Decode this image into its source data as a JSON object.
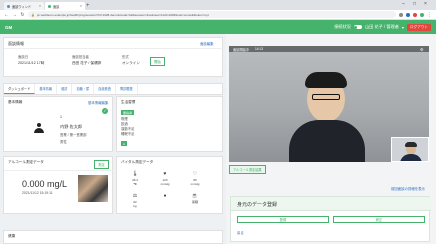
{
  "browser": {
    "tabs": [
      {
        "label": "面談ウィンド",
        "active": false
      },
      {
        "label": "面談",
        "active": true
      }
    ],
    "url": "pc.webdemo.example.jp/health/prog/session/?id=1028-demo&mode=full&session=live&view=1120-2048&role=consult&token=xyz",
    "new_tab": "+",
    "win_controls": [
      "–",
      "□",
      "×"
    ]
  },
  "app_header": {
    "logo": "GM",
    "status_label": "接続状況",
    "user_label": "山田 花子 / 管理者",
    "logout_label": "ログアウト"
  },
  "consult_info": {
    "title": "面談情報",
    "edit_link": "面談編集",
    "fields": [
      {
        "label": "面談日",
        "value": "2021/11/12 17時"
      },
      {
        "label": "面談担当者",
        "value": "西田 花子 / 保健師"
      },
      {
        "label": "形式",
        "value": "オンライン"
      }
    ],
    "action_button": "開始"
  },
  "tabs": [
    "ダッシュボード",
    "基本情報",
    "健診",
    "血糖・尿",
    "血液検査",
    "問診履歴"
  ],
  "basic_info": {
    "title": "基本情報",
    "link": "基本情報編集",
    "id": "1",
    "name": "内野 佐太郎",
    "dept": "営業 / 第一営業部",
    "gender": "男性",
    "status_icon": "check-circle"
  },
  "health_info": {
    "title": "生活習慣",
    "tag": "要指導",
    "items": [
      "喫煙",
      "飲酒",
      "運動不足",
      "睡眠不足"
    ],
    "badge": "A"
  },
  "alcohol": {
    "title": "アルコール測定データ",
    "button": "測定",
    "value": "0.000 mg/L",
    "timestamp": "2021/11/12 15:19:11"
  },
  "vitals": {
    "title": "バイタル測定データ",
    "cells": [
      {
        "icon": "thermometer-icon",
        "value": "36.4",
        "unit": "℃"
      },
      {
        "icon": "heart-icon",
        "value": "120",
        "unit": "mmHg"
      },
      {
        "icon": "pulse-icon",
        "value": "80",
        "unit": "mmHg"
      },
      {
        "icon": "scale-icon",
        "value": "62",
        "unit": "kg"
      },
      {
        "icon": "blood-icon",
        "value": "98",
        "unit": "%"
      },
      {
        "icon": "circle-icon",
        "value": "",
        "unit": ""
      },
      {
        "icon": "cup-icon",
        "value": "",
        "unit": "尿糖"
      }
    ]
  },
  "footer_left": {
    "label": "健康"
  },
  "video": {
    "title": "面談開始中",
    "timer": "14:13",
    "settings_icon": "gear-icon"
  },
  "right_panel": {
    "tab_button": "アルコール測定結果",
    "link_top": "前回面談の詳細を表示",
    "card_title": "身元のデータ登録",
    "btn_left": "登録",
    "btn_right": "修正",
    "footer_link": "戻る"
  },
  "colors": {
    "accent": "#45b36b",
    "danger": "#e2463d",
    "link": "#2a6ebb"
  }
}
